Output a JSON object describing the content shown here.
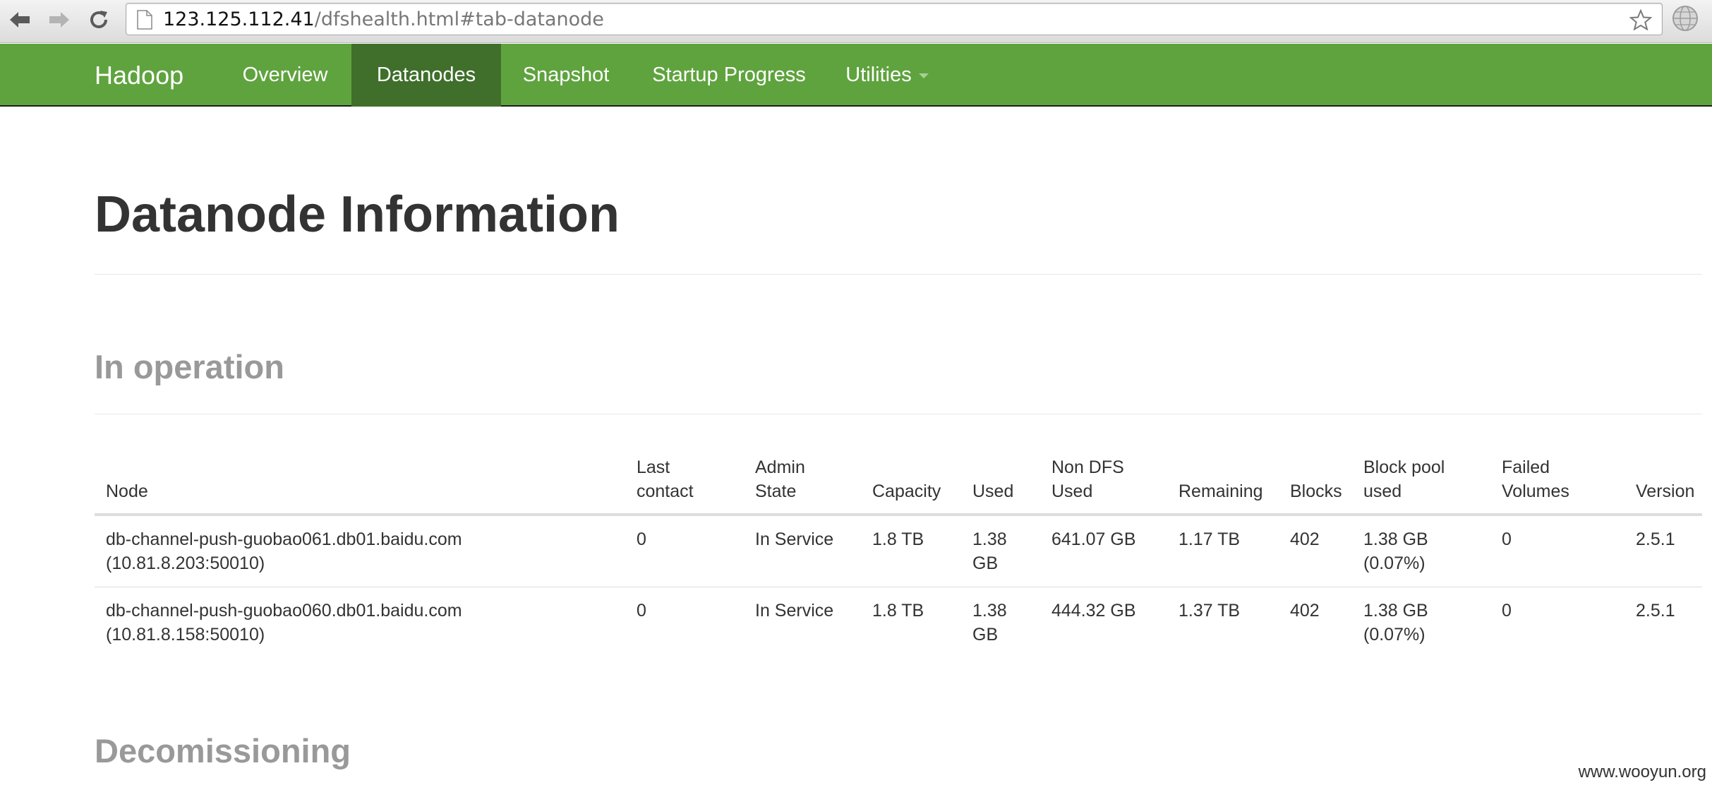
{
  "browser": {
    "url_host": "123.125.112.41",
    "url_path": "/dfshealth.html#tab-datanode"
  },
  "navbar": {
    "brand": "Hadoop",
    "items": [
      {
        "label": "Overview",
        "active": false
      },
      {
        "label": "Datanodes",
        "active": true
      },
      {
        "label": "Snapshot",
        "active": false
      },
      {
        "label": "Startup Progress",
        "active": false
      },
      {
        "label": "Utilities",
        "active": false,
        "dropdown": true
      }
    ]
  },
  "page": {
    "title": "Datanode Information",
    "in_operation_heading": "In operation",
    "decommissioning_heading": "Decomissioning"
  },
  "table": {
    "headers": [
      [
        "Node"
      ],
      [
        "Last",
        "contact"
      ],
      [
        "Admin",
        "State"
      ],
      [
        "Capacity"
      ],
      [
        "Used"
      ],
      [
        "Non DFS",
        "Used"
      ],
      [
        "Remaining"
      ],
      [
        "Blocks"
      ],
      [
        "Block pool",
        "used"
      ],
      [
        "Failed",
        "Volumes"
      ],
      [
        "Version"
      ]
    ],
    "rows": [
      {
        "node": "db-channel-push-guobao061.db01.baidu.com",
        "address": "(10.81.8.203:50010)",
        "last_contact": "0",
        "admin_state": "In Service",
        "capacity": "1.8 TB",
        "used_1": "1.38",
        "used_2": "GB",
        "non_dfs_used": "641.07 GB",
        "remaining": "1.17 TB",
        "blocks": "402",
        "block_pool_used": "1.38 GB",
        "block_pool_pct": "(0.07%)",
        "failed_volumes": "0",
        "version": "2.5.1"
      },
      {
        "node": "db-channel-push-guobao060.db01.baidu.com",
        "address": "(10.81.8.158:50010)",
        "last_contact": "0",
        "admin_state": "In Service",
        "capacity": "1.8 TB",
        "used_1": "1.38",
        "used_2": "GB",
        "non_dfs_used": "444.32 GB",
        "remaining": "1.37 TB",
        "blocks": "402",
        "block_pool_used": "1.38 GB",
        "block_pool_pct": "(0.07%)",
        "failed_volumes": "0",
        "version": "2.5.1"
      }
    ]
  },
  "watermark": "www.wooyun.org",
  "colors": {
    "navbar": "#5fa33e",
    "navbar_active": "#3f6f2b",
    "heading": "#333333",
    "subheading": "#999999"
  }
}
